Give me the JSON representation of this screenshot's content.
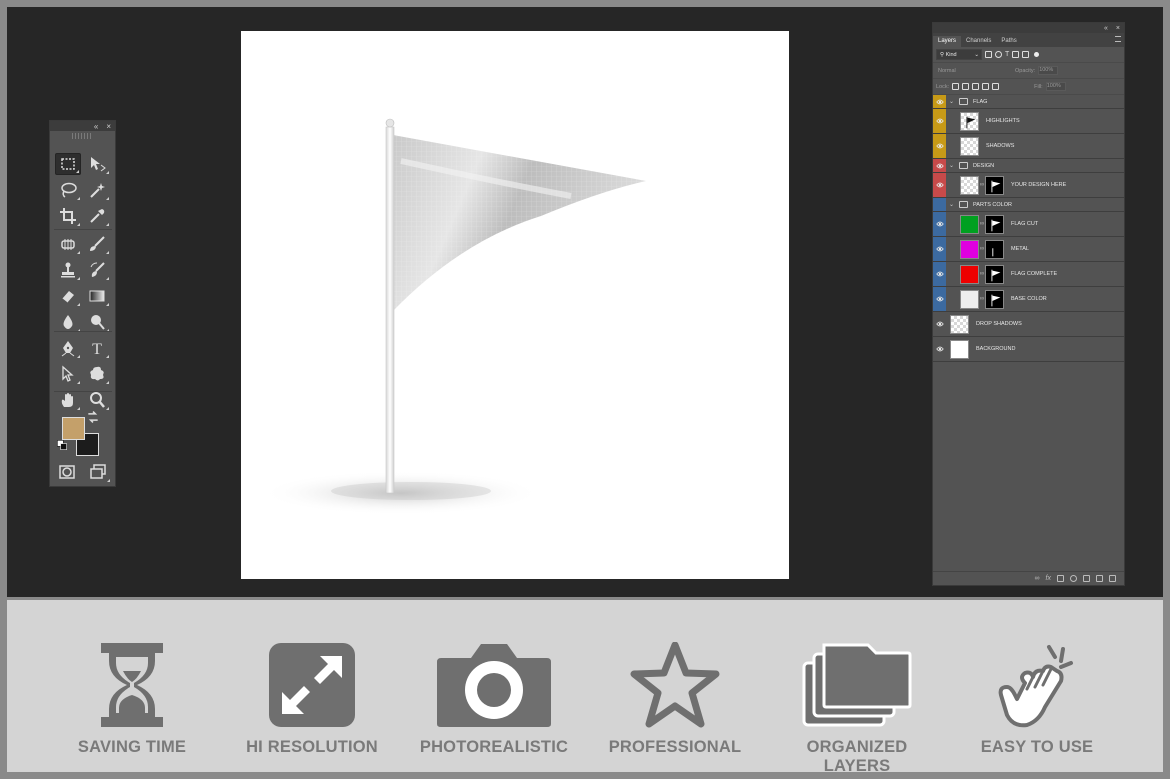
{
  "tools_panel": {
    "collapse_glyph": "«",
    "close_glyph": "×",
    "rows": [
      [
        "rectangular-marquee-tool",
        "move-tool"
      ],
      [
        "lasso-tool",
        "magic-wand-tool"
      ],
      [
        "crop-tool",
        "eyedropper-tool"
      ],
      [
        "healing-brush-tool",
        "brush-tool"
      ],
      [
        "clone-stamp-tool",
        "history-brush-tool"
      ],
      [
        "eraser-tool",
        "gradient-tool"
      ],
      [
        "blur-tool",
        "dodge-tool"
      ],
      [
        "pen-tool",
        "type-tool"
      ],
      [
        "path-selection-tool",
        "custom-shape-tool"
      ],
      [
        "hand-tool",
        "zoom-tool"
      ]
    ],
    "foreground_color": "#c4a06a",
    "background_color": "#1c1c1c",
    "type_glyph": "T"
  },
  "layers_panel": {
    "tabs": [
      "Layers",
      "Channels",
      "Paths"
    ],
    "active_tab": "Layers",
    "filter_kind": "Kind",
    "blend_mode": "Normal",
    "opacity_label": "Opacity:",
    "opacity_value": "100%",
    "lock_label": "Lock:",
    "fill_label": "Fill:",
    "fill_value": "100%",
    "layers": [
      {
        "name": "FLAG",
        "type": "group",
        "color": "#c79a17"
      },
      {
        "name": "HIGHLIGHTS",
        "type": "layer",
        "color": "#c79a17",
        "thumb": "flag-check"
      },
      {
        "name": "SHADOWS",
        "type": "layer",
        "color": "#c79a17",
        "thumb": "check"
      },
      {
        "name": "DESIGN",
        "type": "group",
        "color": "#c74a4a"
      },
      {
        "name": "YOUR DESIGN HERE",
        "type": "smart",
        "color": "#c74a4a",
        "thumb": "check",
        "mask": "flag"
      },
      {
        "name": "PARTS COLOR",
        "type": "group",
        "color": "#3c6aa0",
        "eye_hidden": true
      },
      {
        "name": "FLAG CUT",
        "type": "fill",
        "color": "#3c6aa0",
        "thumb": "#00a020",
        "mask": "flag"
      },
      {
        "name": "METAL",
        "type": "fill",
        "color": "#3c6aa0",
        "thumb": "#e000e0",
        "mask": "pole"
      },
      {
        "name": "FLAG COMPLETE",
        "type": "fill",
        "color": "#3c6aa0",
        "thumb": "#ee0000",
        "mask": "flag"
      },
      {
        "name": "BASE COLOR",
        "type": "fill",
        "color": "#3c6aa0",
        "thumb": "#eeeeee",
        "mask": "flag"
      },
      {
        "name": "DROP SHADOWS",
        "type": "layer",
        "color": "",
        "thumb": "check"
      },
      {
        "name": "BACKGROUND",
        "type": "layer",
        "color": "",
        "thumb": "#ffffff"
      }
    ]
  },
  "features": [
    {
      "icon": "hourglass-icon",
      "label": "SAVING TIME"
    },
    {
      "icon": "expand-icon",
      "label": "HI RESOLUTION"
    },
    {
      "icon": "camera-icon",
      "label": "PHOTOREALISTIC"
    },
    {
      "icon": "star-icon",
      "label": "PROFESSIONAL"
    },
    {
      "icon": "layers-icon",
      "label": "ORGANIZED LAYERS"
    },
    {
      "icon": "hand-pointer-icon",
      "label": "EASY TO USE"
    }
  ]
}
